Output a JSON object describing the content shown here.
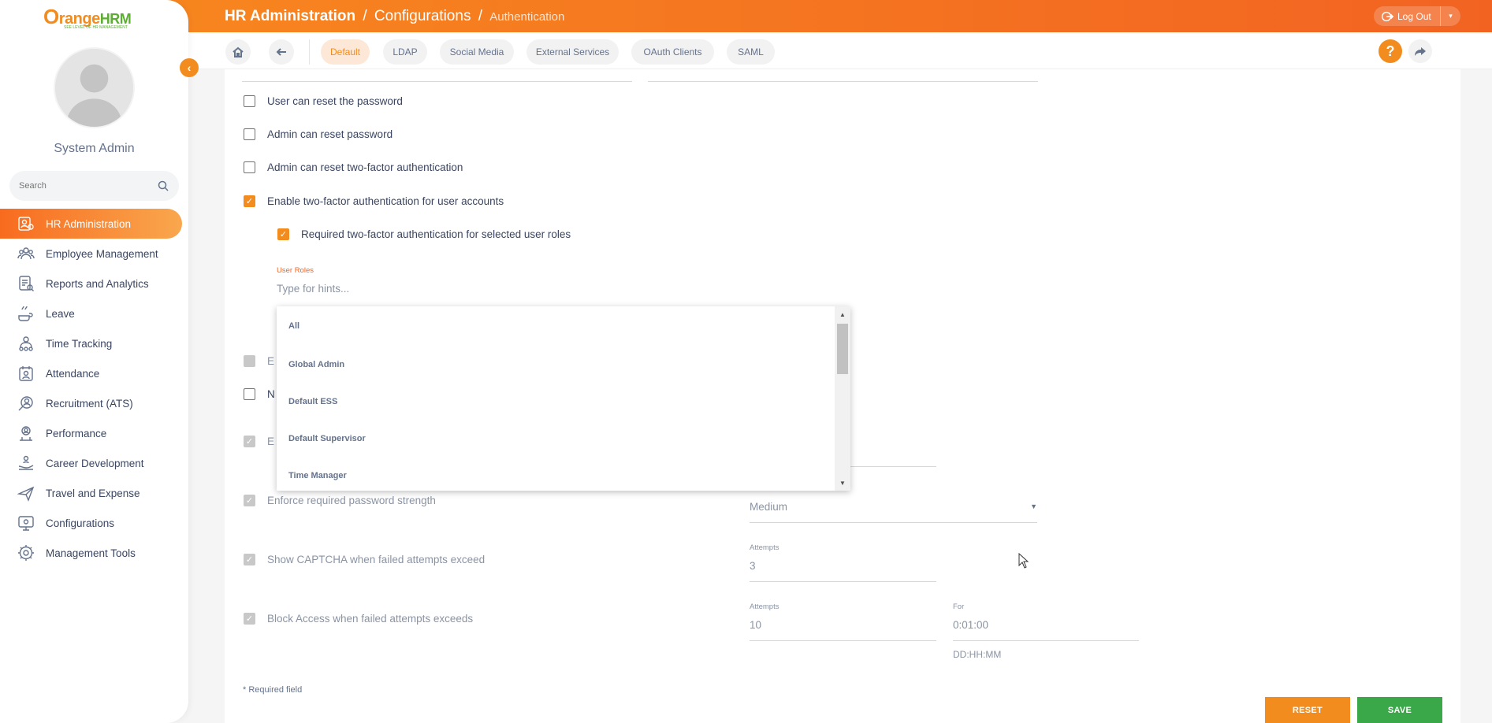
{
  "app": {
    "logo_main": "range",
    "logo_o": "O",
    "logo_hrm": "HRM",
    "logo_tagline": "SEE LEVEL OF HR MANAGEMENT"
  },
  "sidebar": {
    "user_name": "System Admin",
    "search_placeholder": "Search",
    "items": [
      {
        "label": "HR Administration",
        "icon": "hr-admin-icon",
        "active": true
      },
      {
        "label": "Employee Management",
        "icon": "employees-icon"
      },
      {
        "label": "Reports and Analytics",
        "icon": "reports-icon"
      },
      {
        "label": "Leave",
        "icon": "leave-icon"
      },
      {
        "label": "Time Tracking",
        "icon": "time-icon"
      },
      {
        "label": "Attendance",
        "icon": "attendance-icon"
      },
      {
        "label": "Recruitment (ATS)",
        "icon": "recruitment-icon"
      },
      {
        "label": "Performance",
        "icon": "performance-icon"
      },
      {
        "label": "Career Development",
        "icon": "career-icon"
      },
      {
        "label": "Travel and Expense",
        "icon": "travel-icon"
      },
      {
        "label": "Configurations",
        "icon": "configurations-icon"
      },
      {
        "label": "Management Tools",
        "icon": "tools-icon"
      }
    ]
  },
  "header": {
    "crumb1": "HR Administration",
    "crumb2": "Configurations",
    "crumb3": "Authentication",
    "sep": "/",
    "logout_label": "Log Out",
    "logout_dropdown": "▾"
  },
  "tabs": [
    {
      "label": "Default",
      "active": true
    },
    {
      "label": "LDAP"
    },
    {
      "label": "Social Media"
    },
    {
      "label": "External Services"
    },
    {
      "label": "OAuth Clients"
    },
    {
      "label": "SAML"
    }
  ],
  "help_label": "?",
  "form": {
    "user_reset_password": "User can reset the password",
    "admin_reset_password": "Admin can reset password",
    "admin_reset_2fa": "Admin can reset two-factor authentication",
    "enable_2fa": "Enable two-factor authentication for user accounts",
    "required_2fa_roles": "Required two-factor authentication for selected user roles",
    "user_roles_label": "User Roles",
    "user_roles_placeholder": "Type for hints...",
    "hidden_row_1_prefix": "E",
    "hidden_row_2_prefix": "N",
    "hidden_row_3_prefix": "E",
    "enforce_strength": "Enforce required password strength",
    "strength_value": "Medium",
    "captcha": "Show CAPTCHA when failed attempts exceed",
    "captcha_attempts_label": "Attempts",
    "captcha_attempts_value": "3",
    "block_access": "Block Access when failed attempts exceeds",
    "block_attempts_label": "Attempts",
    "block_attempts_value": "10",
    "block_for_label": "For",
    "block_for_value": "0:01:00",
    "block_for_hint": "DD:HH:MM",
    "required_note": "* Required field",
    "reset_label": "RESET",
    "save_label": "SAVE"
  },
  "dropdown": {
    "options": [
      "All",
      "Global Admin",
      "Default ESS",
      "Default Supervisor",
      "Time Manager"
    ],
    "scroll_up": "▲",
    "scroll_down": "▼"
  },
  "colors": {
    "accent": "#f28c1e",
    "save_green": "#3aa849",
    "header_gradient_end": "#f26322"
  }
}
